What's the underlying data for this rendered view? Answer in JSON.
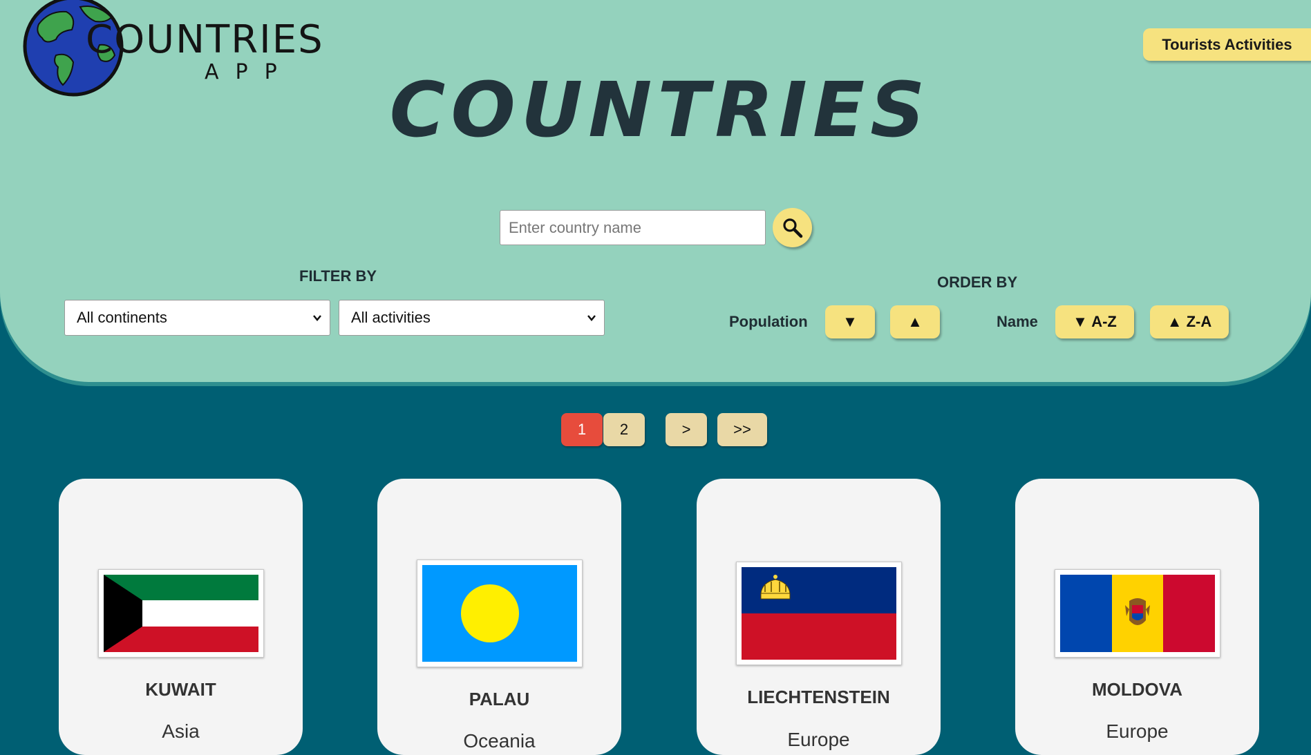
{
  "app": {
    "logo_word": "COUNTRIES",
    "logo_sub": "APP",
    "title": "COUNTRIES",
    "tourists_button": "Tourists Activities"
  },
  "search": {
    "placeholder": "Enter country name",
    "icon": "search-icon"
  },
  "filter": {
    "label": "FILTER BY",
    "continents_selected": "All continents",
    "activities_selected": "All activities"
  },
  "order": {
    "label": "ORDER BY",
    "population_label": "Population",
    "population_desc": "▼",
    "population_asc": "▲",
    "name_label": "Name",
    "name_az": "▼ A-Z",
    "name_za": "▲ Z-A"
  },
  "pagination": {
    "pages": [
      "1",
      "2"
    ],
    "active_page": "1",
    "next": ">",
    "last": ">>"
  },
  "countries": [
    {
      "name": "KUWAIT",
      "continent": "Asia",
      "flag": "kuwait-flag"
    },
    {
      "name": "PALAU",
      "continent": "Oceania",
      "flag": "palau-flag"
    },
    {
      "name": "LIECHTENSTEIN",
      "continent": "Europe",
      "flag": "liechtenstein-flag"
    },
    {
      "name": "MOLDOVA",
      "continent": "Europe",
      "flag": "moldova-flag"
    }
  ],
  "colors": {
    "header_bg": "#94d2bd",
    "page_bg": "#005f73",
    "button_yellow": "#f6e27f",
    "active_page": "#e74c3c",
    "inactive_page": "#e9d8a6",
    "card_bg": "#f4f4f4"
  }
}
